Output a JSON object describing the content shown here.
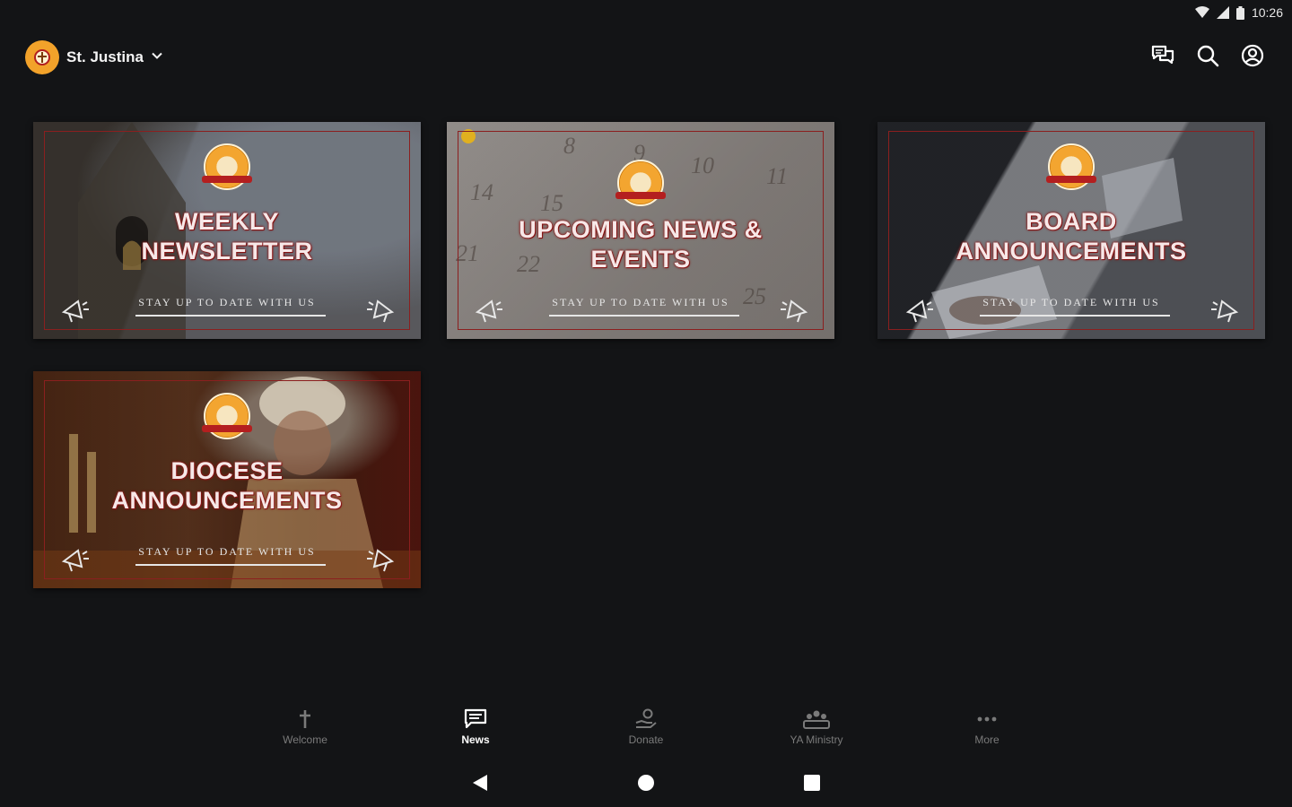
{
  "status_bar": {
    "time": "10:26",
    "wifi_icon": "wifi-icon",
    "signal_icon": "signal-icon",
    "battery_icon": "battery-icon"
  },
  "app_bar": {
    "church_name": "St. Justina",
    "actions": [
      {
        "icon": "chat-icon"
      },
      {
        "icon": "search-icon"
      },
      {
        "icon": "account-icon"
      }
    ]
  },
  "cards": [
    {
      "title_line1": "WEEKLY",
      "title_line2": "NEWSLETTER",
      "tagline": "STAY UP TO DATE WITH US"
    },
    {
      "title_line1": "UPCOMING NEWS &",
      "title_line2": "EVENTS",
      "tagline": "STAY UP TO DATE WITH US",
      "calendar_numbers": [
        "8",
        "9",
        "10",
        "11",
        "14",
        "15",
        "21",
        "22",
        "25"
      ]
    },
    {
      "title_line1": "BOARD",
      "title_line2": "ANNOUNCEMENTS",
      "tagline": "STAY UP TO DATE WITH US"
    },
    {
      "title_line1": "DIOCESE",
      "title_line2": "ANNOUNCEMENTS",
      "tagline": "STAY UP TO DATE WITH US"
    }
  ],
  "bottom_nav": [
    {
      "label": "Welcome",
      "icon": "cross-icon",
      "active": false
    },
    {
      "label": "News",
      "icon": "news-icon",
      "active": true
    },
    {
      "label": "Donate",
      "icon": "donate-icon",
      "active": false
    },
    {
      "label": "YA Ministry",
      "icon": "group-icon",
      "active": false
    },
    {
      "label": "More",
      "icon": "more-icon",
      "active": false
    }
  ],
  "colors": {
    "background": "#131416",
    "accent_red": "#b11e1e",
    "inactive_nav": "#7a7a7a"
  }
}
